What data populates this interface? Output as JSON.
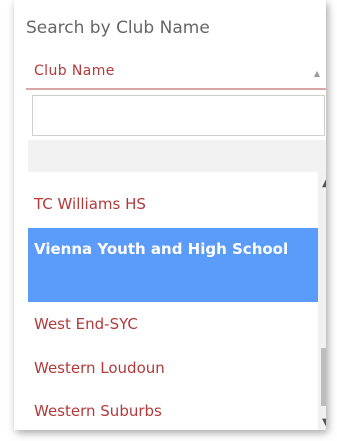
{
  "search": {
    "label": "Search by Club Name",
    "select_value": "Club Name",
    "filter_value": "",
    "filter_placeholder": ""
  },
  "clubs": [
    {
      "label": "TC Williams HS",
      "selected": false
    },
    {
      "label": "Vienna Youth and High School",
      "selected": true
    },
    {
      "label": "West End-SYC",
      "selected": false
    },
    {
      "label": "Western Loudoun",
      "selected": false
    },
    {
      "label": "Western Suburbs",
      "selected": false
    }
  ],
  "icons": {
    "select_arrow": "chevron-up-icon",
    "scroll_up": "scroll-up-icon",
    "scroll_down": "scroll-down-icon"
  },
  "colors": {
    "accent": "#b23a3a",
    "selected_bg": "#5b9bf9",
    "selected_text": "#ffffff"
  }
}
